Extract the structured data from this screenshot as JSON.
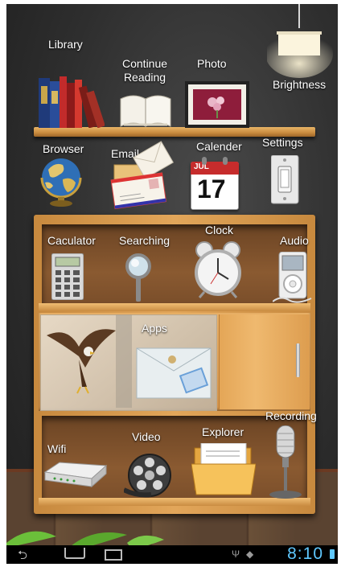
{
  "apps": {
    "library": "Library",
    "continue_reading": "Continue\nReading",
    "photo": "Photo",
    "brightness": "Brightness",
    "browser": "Browser",
    "email": "Email",
    "calendar": "Calender",
    "settings": "Settings",
    "calculator": "Caculator",
    "searching": "Searching",
    "clock": "Clock",
    "audio": "Audio",
    "apps": "Apps",
    "wifi": "Wifi",
    "video": "Video",
    "explorer": "Explorer",
    "recording": "Recording"
  },
  "calendar_icon": {
    "month": "JUL",
    "day": "17"
  },
  "status_bar": {
    "time": "8:10"
  },
  "colors": {
    "clock_accent": "#5fc8ff",
    "wood": "#d4934a"
  },
  "icons": [
    "books-icon",
    "open-book-icon",
    "photo-frame-icon",
    "lamp-icon",
    "globe-icon",
    "envelope-icon",
    "calendar-icon",
    "switch-icon",
    "calculator-icon",
    "magnifier-icon",
    "alarm-clock-icon",
    "ipod-icon",
    "eagle-icon",
    "folder-icon",
    "router-icon",
    "film-reel-icon",
    "file-folder-icon",
    "microphone-icon",
    "back-icon",
    "home-icon",
    "recent-apps-icon",
    "usb-icon",
    "android-debug-icon"
  ]
}
